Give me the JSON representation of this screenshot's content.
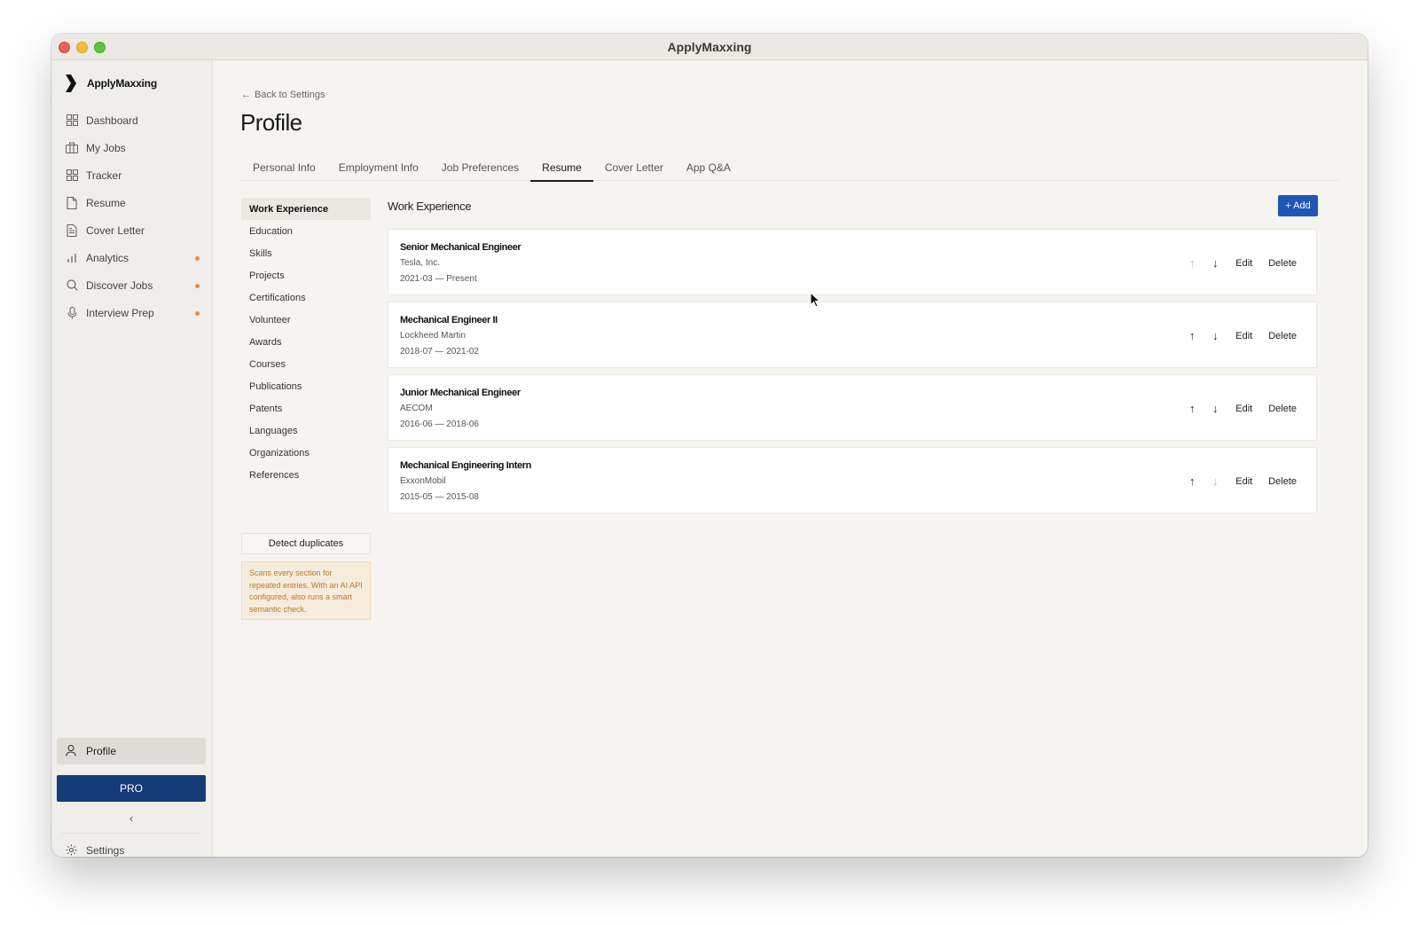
{
  "window": {
    "title": "ApplyMaxxing"
  },
  "sidebar": {
    "brand": "ApplyMaxxing",
    "items": [
      {
        "label": "Dashboard",
        "icon": "grid-icon",
        "dot": false
      },
      {
        "label": "My Jobs",
        "icon": "briefcase-icon",
        "dot": false
      },
      {
        "label": "Tracker",
        "icon": "grid-icon",
        "dot": false
      },
      {
        "label": "Resume",
        "icon": "file-icon",
        "dot": false
      },
      {
        "label": "Cover Letter",
        "icon": "document-icon",
        "dot": false
      },
      {
        "label": "Analytics",
        "icon": "bar-chart-icon",
        "dot": true
      },
      {
        "label": "Discover Jobs",
        "icon": "search-icon",
        "dot": true
      },
      {
        "label": "Interview Prep",
        "icon": "microphone-icon",
        "dot": true
      }
    ],
    "profile_label": "Profile",
    "pro_label": "PRO",
    "collapse_label": "‹",
    "settings_label": "Settings",
    "dot_color": "#e98b3c"
  },
  "main": {
    "back_label": "Back to Settings",
    "page_title": "Profile",
    "tabs": [
      "Personal Info",
      "Employment Info",
      "Job Preferences",
      "Resume",
      "Cover Letter",
      "App Q&A"
    ],
    "active_tab": "Resume",
    "subnav": [
      "Work Experience",
      "Education",
      "Skills",
      "Projects",
      "Certifications",
      "Volunteer",
      "Awards",
      "Courses",
      "Publications",
      "Patents",
      "Languages",
      "Organizations",
      "References"
    ],
    "active_subnav": "Work Experience",
    "detect_label": "Detect duplicates",
    "detect_note": "Scans every section for repeated entries. With an AI API configured, also runs a smart semantic check.",
    "section_title": "Work Experience",
    "add_label": "+ Add",
    "edit_label": "Edit",
    "delete_label": "Delete",
    "entries": [
      {
        "title": "Senior Mechanical Engineer",
        "company": "Tesla, Inc.",
        "dates": "2021-03 — Present",
        "up_enabled": false,
        "down_enabled": true
      },
      {
        "title": "Mechanical Engineer II",
        "company": "Lockheed Martin",
        "dates": "2018-07 — 2021-02",
        "up_enabled": true,
        "down_enabled": true
      },
      {
        "title": "Junior Mechanical Engineer",
        "company": "AECOM",
        "dates": "2016-06 — 2018-06",
        "up_enabled": true,
        "down_enabled": true
      },
      {
        "title": "Mechanical Engineering Intern",
        "company": "ExxonMobil",
        "dates": "2015-05 — 2015-08",
        "up_enabled": true,
        "down_enabled": false
      }
    ],
    "accent_color": "#1f56b8",
    "pro_color": "#143a78"
  }
}
